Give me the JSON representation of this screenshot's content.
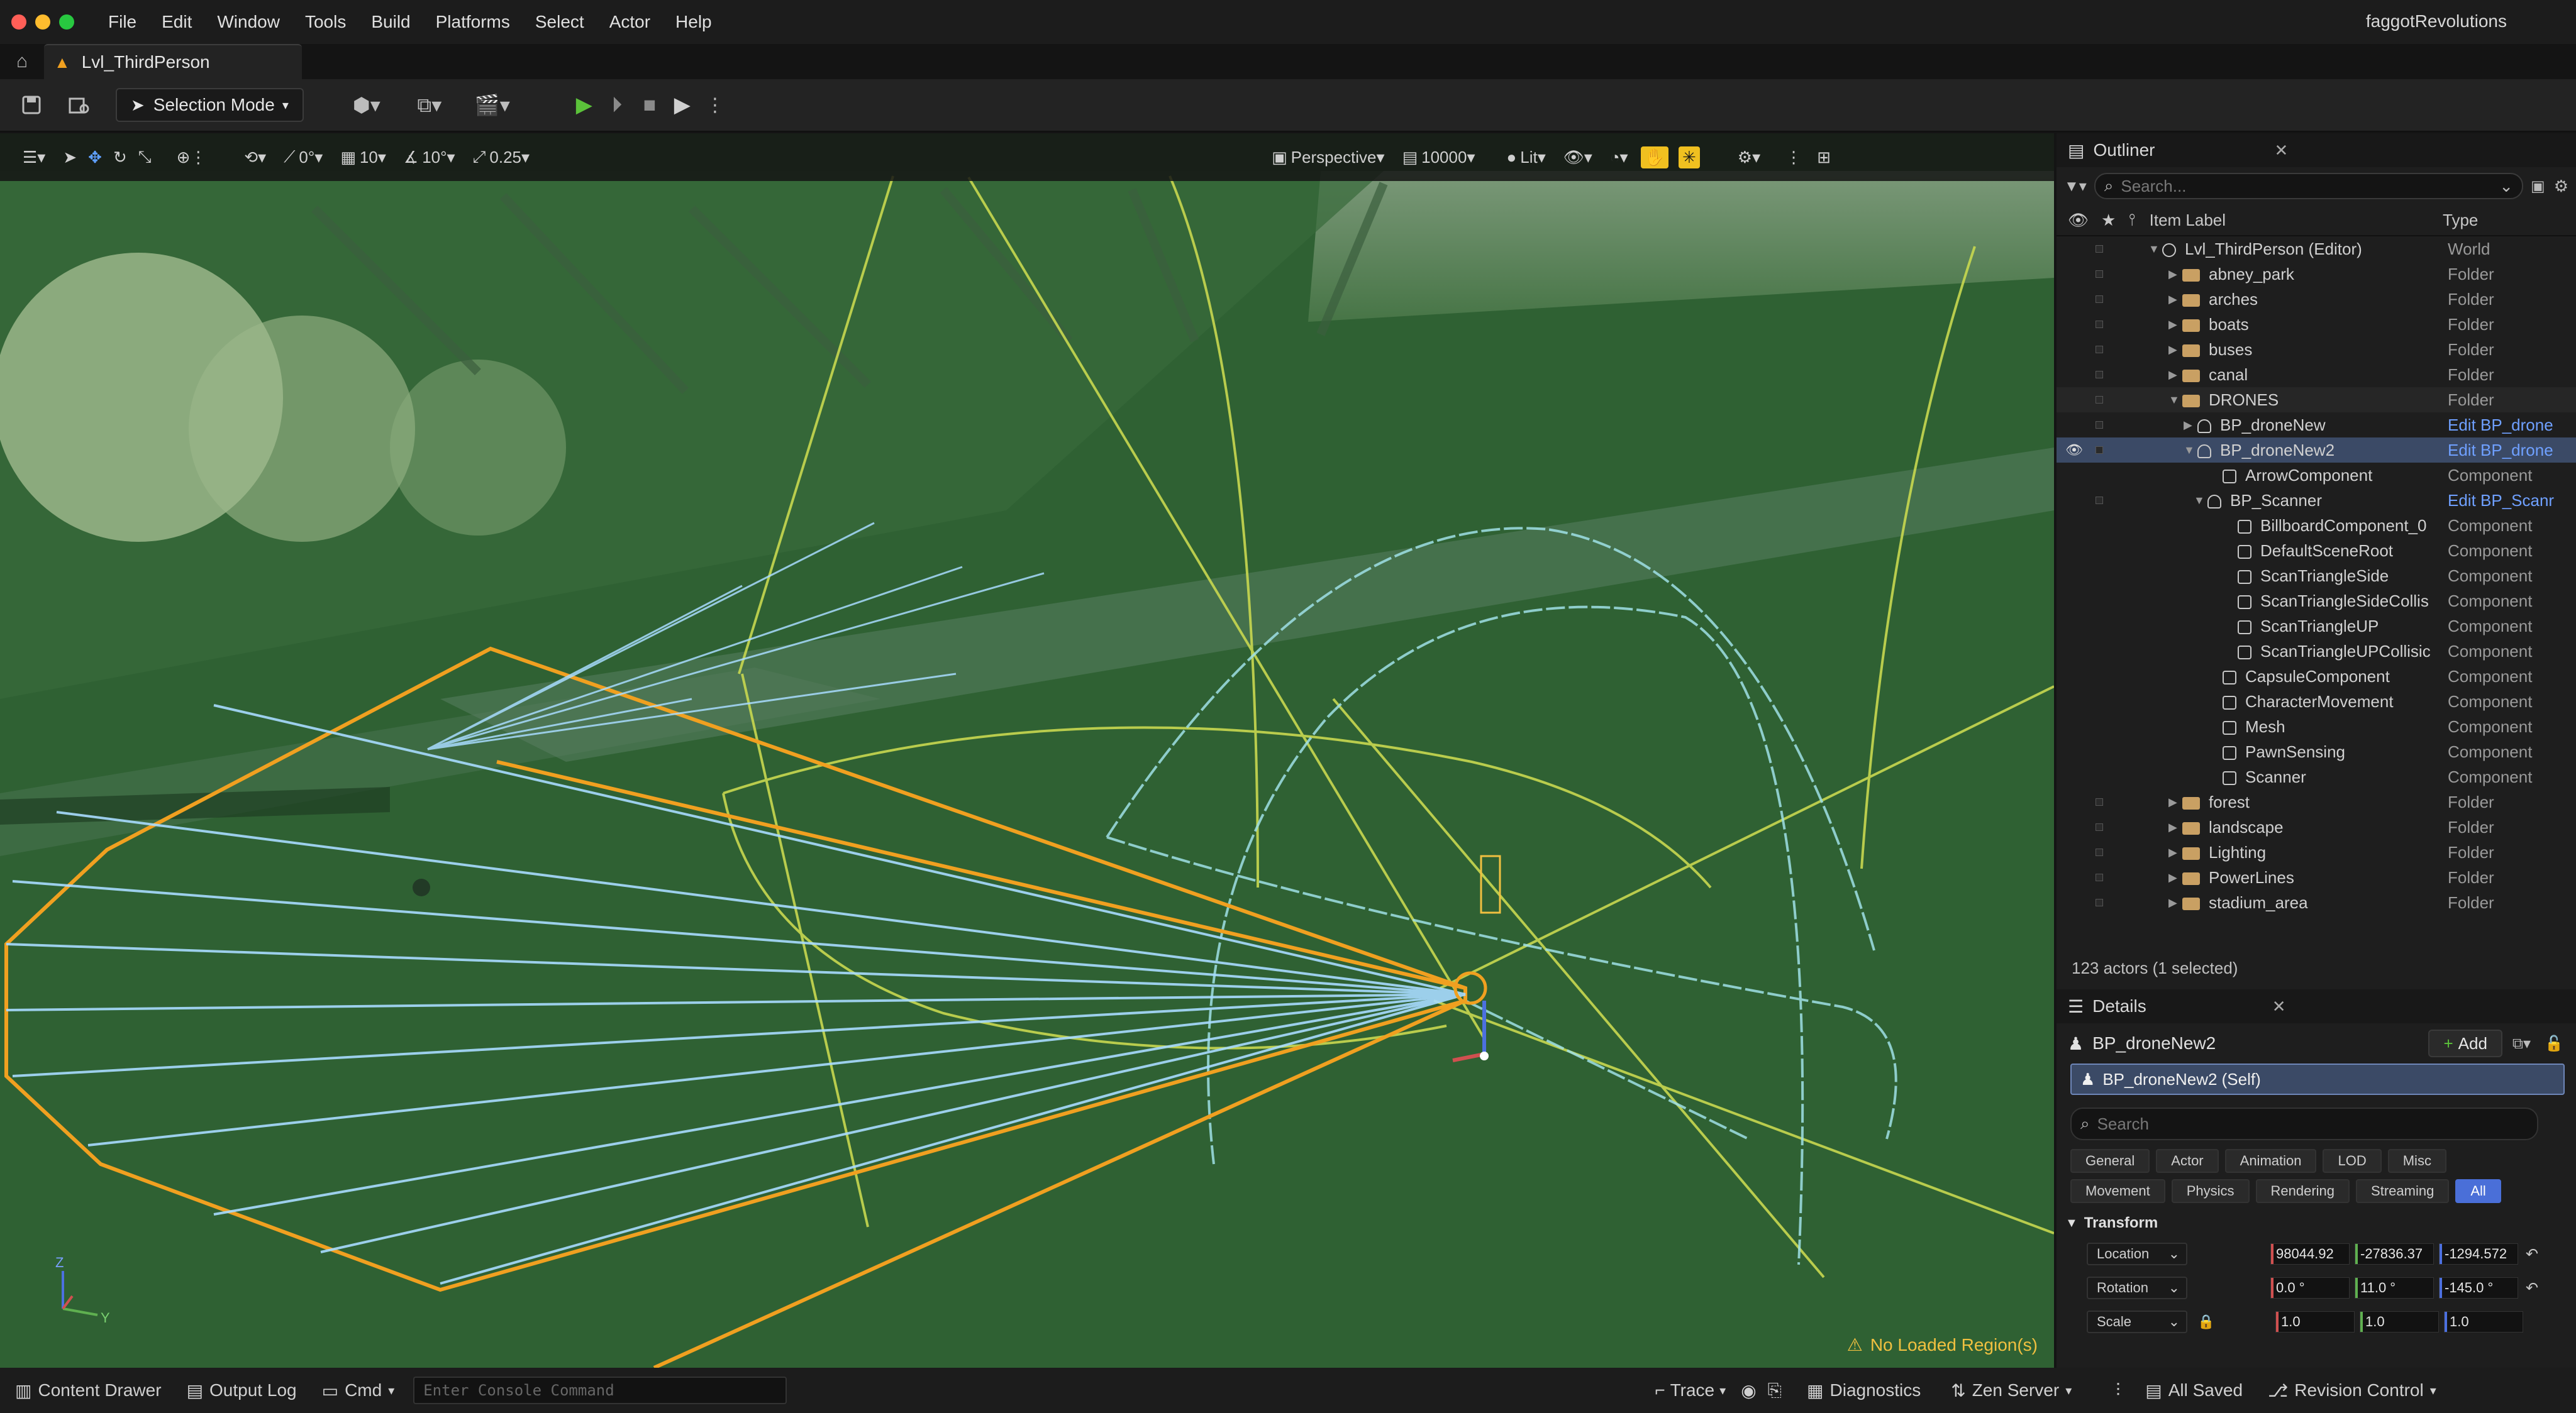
{
  "menu": {
    "items": [
      "File",
      "Edit",
      "Window",
      "Tools",
      "Build",
      "Platforms",
      "Select",
      "Actor",
      "Help"
    ],
    "project_name": "faggotRevolutions"
  },
  "tab": {
    "level_name": "Lvl_ThirdPerson"
  },
  "toolbar": {
    "mode_label": "Selection Mode"
  },
  "viewport_toolbar": {
    "rotation_snap": "0°",
    "grid_snap": "10",
    "angle_snap": "10°",
    "scale_snap": "0.25",
    "view_mode": "Perspective",
    "camera_speed": "10000",
    "lighting_mode": "Lit"
  },
  "viewport": {
    "warning": "No Loaded Region(s)",
    "axis_z": "Z",
    "axis_y": "Y"
  },
  "outliner": {
    "title": "Outliner",
    "search_placeholder": "Search...",
    "col_label": "Item Label",
    "col_type": "Type",
    "rows": [
      {
        "label": "Lvl_ThirdPerson (Editor)",
        "type": "World"
      },
      {
        "label": "abney_park",
        "type": "Folder"
      },
      {
        "label": "arches",
        "type": "Folder"
      },
      {
        "label": "boats",
        "type": "Folder"
      },
      {
        "label": "buses",
        "type": "Folder"
      },
      {
        "label": "canal",
        "type": "Folder"
      },
      {
        "label": "DRONES",
        "type": "Folder"
      },
      {
        "label": "BP_droneNew",
        "type": "Edit BP_drone"
      },
      {
        "label": "BP_droneNew2",
        "type": "Edit BP_drone"
      },
      {
        "label": "ArrowComponent",
        "type": "Component"
      },
      {
        "label": "BP_Scanner",
        "type": "Edit BP_Scanr"
      },
      {
        "label": "BillboardComponent_0",
        "type": "Component"
      },
      {
        "label": "DefaultSceneRoot",
        "type": "Component"
      },
      {
        "label": "ScanTriangleSide",
        "type": "Component"
      },
      {
        "label": "ScanTriangleSideCollis",
        "type": "Component"
      },
      {
        "label": "ScanTriangleUP",
        "type": "Component"
      },
      {
        "label": "ScanTriangleUPCollisic",
        "type": "Component"
      },
      {
        "label": "CapsuleComponent",
        "type": "Component"
      },
      {
        "label": "CharacterMovement",
        "type": "Component"
      },
      {
        "label": "Mesh",
        "type": "Component"
      },
      {
        "label": "PawnSensing",
        "type": "Component"
      },
      {
        "label": "Scanner",
        "type": "Component"
      },
      {
        "label": "forest",
        "type": "Folder"
      },
      {
        "label": "landscape",
        "type": "Folder"
      },
      {
        "label": "Lighting",
        "type": "Folder"
      },
      {
        "label": "PowerLines",
        "type": "Folder"
      },
      {
        "label": "stadium_area",
        "type": "Folder"
      }
    ],
    "actor_count": "123 actors (1 selected)"
  },
  "details": {
    "title": "Details",
    "actor_name": "BP_droneNew2",
    "add_label": "Add",
    "self_label": "BP_droneNew2 (Self)",
    "search_placeholder": "Search",
    "categories_row1": [
      "General",
      "Actor",
      "Animation",
      "LOD",
      "Misc"
    ],
    "categories_row2": [
      "Movement",
      "Physics",
      "Rendering",
      "Streaming",
      "All"
    ],
    "transform_title": "Transform",
    "location_label": "Location",
    "location": [
      "98044.92",
      "-27836.37",
      "-1294.572"
    ],
    "rotation_label": "Rotation",
    "rotation": [
      "0.0 °",
      "11.0 °",
      "-145.0 °"
    ],
    "scale_label": "Scale",
    "scale": [
      "1.0",
      "1.0",
      "1.0"
    ]
  },
  "statusbar": {
    "content_drawer": "Content Drawer",
    "output_log": "Output Log",
    "cmd": "Cmd",
    "console_placeholder": "Enter Console Command",
    "trace": "Trace",
    "diagnostics": "Diagnostics",
    "zen_server": "Zen Server",
    "all_saved": "All Saved",
    "revision_control": "Revision Control"
  },
  "colors": {
    "accent_blue": "#4a6fd8",
    "selection_bg": "#3b4a66",
    "viewport_green": "#2c5f32",
    "warning_yellow": "#f0c040"
  }
}
